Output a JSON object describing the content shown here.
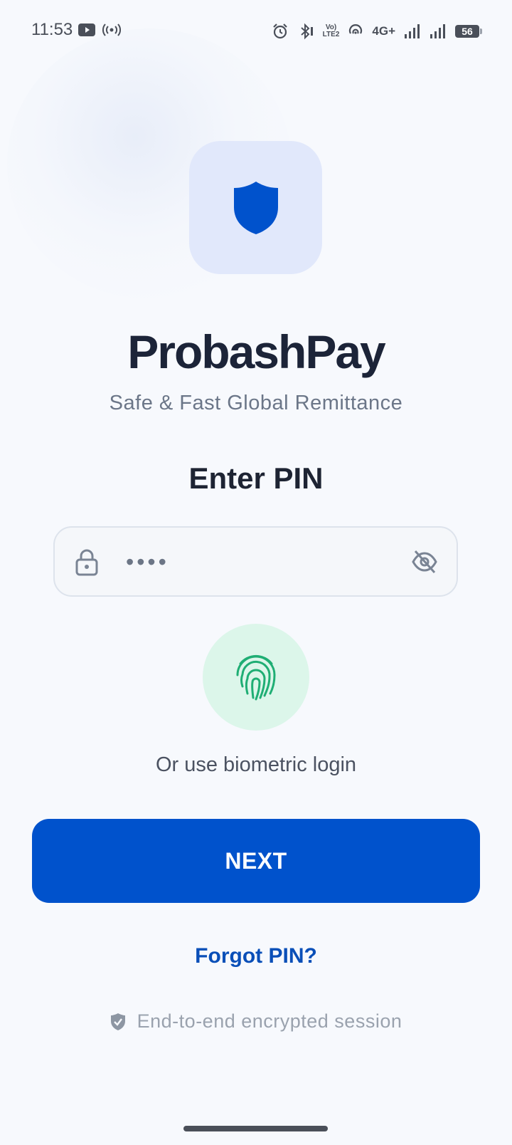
{
  "status_bar": {
    "time": "11:53",
    "network": "4G+",
    "volte_line1": "Vo)",
    "volte_line2": "LTE2",
    "battery": "56"
  },
  "app": {
    "name": "ProbashPay",
    "tagline": "Safe & Fast Global Remittance",
    "accent_color": "#0052cc"
  },
  "pin": {
    "title": "Enter PIN",
    "value": "••••"
  },
  "biometric": {
    "label": "Or use biometric login",
    "color": "#1fae74"
  },
  "actions": {
    "next_label": "NEXT",
    "forgot_label": "Forgot PIN?"
  },
  "footer": {
    "text": "End-to-end encrypted session"
  },
  "icons": {
    "logo": "shield-icon",
    "lock": "lock-icon",
    "visibility": "eye-off-icon",
    "biometric": "fingerprint-icon",
    "footer": "shield-check-icon"
  }
}
